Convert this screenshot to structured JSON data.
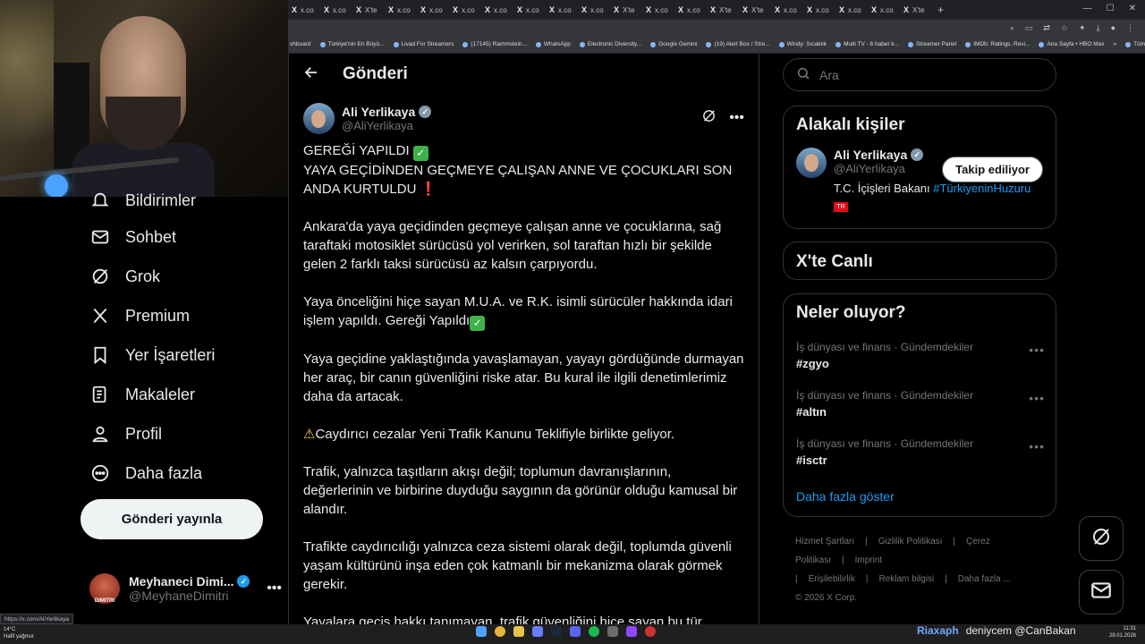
{
  "browser": {
    "tabs": [
      "x.co",
      "x.co",
      "X'te",
      "x.co",
      "x.co",
      "x.co",
      "x.co",
      "x.co",
      "x.co",
      "x.co",
      "X'te",
      "x.co",
      "x.co",
      "X'te",
      "X'te",
      "x.co",
      "x.co",
      "x.co",
      "x.co",
      "X'te"
    ],
    "new_tab": "+",
    "bookmarks": [
      "shboard",
      "Türkiye'nin En Büyü...",
      "Livad For Streamers",
      "(17145) Rammstein...",
      "WhatsApp",
      "Electronic Diversity...",
      "Google Gemini",
      "(19) Alert Box / Stre...",
      "Windy: Sıcaklık",
      "Multi TV - 6 haber k...",
      "Streamer Panel",
      "IMDb: Ratings, Revi...",
      "Ana Sayfa • HBO Max",
      "»",
      "Tüm Yer İşaretleri"
    ],
    "status_url": "https://x.com/AliYerlikaya"
  },
  "nav": {
    "items": [
      {
        "label": "Bildirimler",
        "icon": "bell-icon"
      },
      {
        "label": "Sohbet",
        "icon": "mail-icon"
      },
      {
        "label": "Grok",
        "icon": "grok-icon"
      },
      {
        "label": "Premium",
        "icon": "x-logo-icon"
      },
      {
        "label": "Yer İşaretleri",
        "icon": "bookmark-icon"
      },
      {
        "label": "Makaleler",
        "icon": "article-icon"
      },
      {
        "label": "Profil",
        "icon": "person-icon"
      },
      {
        "label": "Daha fazla",
        "icon": "more-circle-icon"
      }
    ],
    "post_button": "Gönderi yayınla",
    "account": {
      "display_name": "Meyhaneci Dimi...",
      "handle": "@MeyhaneDimitri",
      "avatar_text": "DIMITRI"
    }
  },
  "main": {
    "title": "Gönderi",
    "author": {
      "name": "Ali Yerlikaya",
      "handle": "@AliYerlikaya"
    },
    "post": {
      "line1": "GEREĞİ YAPILDI ",
      "line2": "YAYA GEÇİDİNDEN GEÇMEYE ÇALIŞAN ANNE VE ÇOCUKLARI SON ANDA KURTULDU ",
      "red_mark": "❗",
      "check": "✓",
      "p2": "Ankara'da yaya geçidinden geçmeye çalışan anne ve çocuklarına, sağ taraftaki motosiklet sürücüsü yol verirken, sol taraftan hızlı bir şekilde gelen 2 farklı taksi sürücüsü az kalsın çarpıyordu.",
      "p3": "Yaya önceliğini hiçe sayan M.U.A. ve R.K. isimli sürücüler hakkında idari işlem yapıldı. Gereği Yapıldı",
      "p4": "Yaya geçidine yaklaştığında yavaşlamayan, yayayı gördüğünde durmayan her araç, bir canın güvenliğini riske atar. Bu kural ile ilgili denetimlerimiz daha da artacak.",
      "warn_mark": "⚠",
      "p5": "Caydırıcı cezalar Yeni Trafik Kanunu Teklifiyle birlikte geliyor.",
      "p6": "Trafik, yalnızca taşıtların akışı değil; toplumun davranışlarının, değerlerinin ve birbirine duyduğu saygının da görünür olduğu kamusal bir alandır.",
      "p7": "Trafikte caydırıcılığı yalnızca ceza sistemi olarak değil, toplumda güvenli yaşam kültürünü inşa eden çok katmanlı bir mekanizma olarak görmek gerekir.",
      "p8": "Yayalara geçiş hakkı tanımayan, trafik güvenliğini hiçe sayan bu tür"
    }
  },
  "right": {
    "search_placeholder": "Ara",
    "related_title": "Alakalı kişiler",
    "related": {
      "name": "Ali Yerlikaya",
      "handle": "@AliYerlikaya",
      "bio": "T.C. İçişleri Bakanı ",
      "bio_link": "#TürkiyeninHuzuru",
      "follow_label": "Takip ediliyor",
      "flag": "TR"
    },
    "live_title": "X'te Canlı",
    "trends_title": "Neler oluyor?",
    "trends": [
      {
        "meta": "İş dünyası ve finans · Gündemdekiler",
        "tag": "#zgyo"
      },
      {
        "meta": "İş dünyası ve finans · Gündemdekiler",
        "tag": "#altın"
      },
      {
        "meta": "İş dünyası ve finans · Gündemdekiler",
        "tag": "#isctr"
      }
    ],
    "show_more": "Daha fazla göster",
    "footer": [
      "Hizmet Şartları",
      "|",
      "Gizlilik Politikası",
      "|",
      "Çerez Politikası",
      "|",
      "Imprint",
      "|",
      "Erişilebilirlik",
      "|",
      "Reklam bilgisi",
      "|",
      "Daha fazla ...",
      "© 2026 X Corp."
    ]
  },
  "taskbar": {
    "weather_temp": "14°C",
    "weather_desc": "Hafif yağmur",
    "chat_user": "Riaxaph",
    "chat_msg": "deniycem @CanBakan",
    "time": "11:31",
    "date": "29.01.2026"
  }
}
